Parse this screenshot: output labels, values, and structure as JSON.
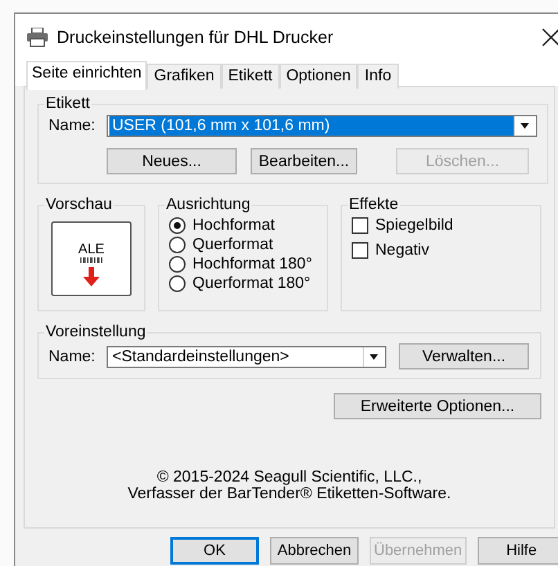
{
  "window": {
    "title": "Druckeinstellungen für DHL Drucker"
  },
  "tabs": [
    {
      "label": "Seite einrichten",
      "selected": true
    },
    {
      "label": "Grafiken",
      "selected": false
    },
    {
      "label": "Etikett",
      "selected": false
    },
    {
      "label": "Optionen",
      "selected": false
    },
    {
      "label": "Info",
      "selected": false
    }
  ],
  "etikett": {
    "title": "Etikett",
    "name_label": "Name:",
    "value": "USER (101,6 mm x 101,6 mm)",
    "highlighted": true,
    "buttons": [
      {
        "label": "Neues...",
        "disabled": false
      },
      {
        "label": "Bearbeiten...",
        "disabled": false
      },
      {
        "label": "Löschen...",
        "disabled": true
      }
    ]
  },
  "vorschau": {
    "title": "Vorschau",
    "sample_text": "ALE"
  },
  "ausrichtung": {
    "title": "Ausrichtung",
    "options": [
      {
        "label": "Hochformat",
        "selected": true
      },
      {
        "label": "Querformat",
        "selected": false
      },
      {
        "label": "Hochformat 180°",
        "selected": false
      },
      {
        "label": "Querformat 180°",
        "selected": false
      }
    ]
  },
  "effekte": {
    "title": "Effekte",
    "options": [
      {
        "label": "Spiegelbild",
        "checked": false
      },
      {
        "label": "Negativ",
        "checked": false
      }
    ]
  },
  "voreinstellung": {
    "title": "Voreinstellung",
    "name_label": "Name:",
    "value": "<Standardeinstellungen>",
    "button": "Verwalten..."
  },
  "advanced_button": "Erweiterte Optionen...",
  "copyright": [
    "© 2015-2024 Seagull Scientific, LLC.,",
    "Verfasser der BarTender® Etiketten-Software."
  ],
  "buttons": [
    {
      "label": "OK",
      "default": true,
      "disabled": false
    },
    {
      "label": "Abbrechen",
      "default": false,
      "disabled": false
    },
    {
      "label": "Übernehmen",
      "default": false,
      "disabled": true
    },
    {
      "label": "Hilfe",
      "default": false,
      "disabled": false
    }
  ]
}
